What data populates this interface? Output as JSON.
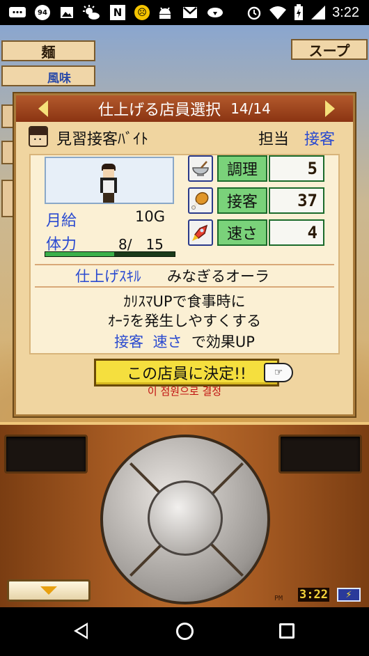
{
  "status_bar": {
    "time": "3:22",
    "icons": [
      "message-icon",
      "badge-94-icon",
      "image-icon",
      "weather-icon",
      "n-news-icon",
      "smiley-icon",
      "android-icon",
      "gmail-icon",
      "cloud-download-icon",
      "alarm-icon",
      "wifi-icon",
      "battery-charging-icon",
      "signal-icon"
    ],
    "badge_count": "94",
    "n_label": "N"
  },
  "background": {
    "left_tab": "麺",
    "right_tab": "スープ",
    "flavor": "風味"
  },
  "dialog": {
    "title": "仕上げる店員選択",
    "count": "14/14",
    "staff_name": "見習接客ﾊﾞｲﾄ",
    "role_label": "担当",
    "role_value": "接客",
    "salary_label": "月給",
    "salary_value": "10G",
    "stamina_label": "体力",
    "stamina_value": "8/　15",
    "stamina_current": 8,
    "stamina_max": 15,
    "stats": [
      {
        "name": "調理",
        "value": "5",
        "icon": "cooking-bowl-icon"
      },
      {
        "name": "接客",
        "value": "37",
        "icon": "chicken-leg-icon"
      },
      {
        "name": "速さ",
        "value": "4",
        "icon": "rocket-icon"
      }
    ],
    "skill_label": "仕上げｽｷﾙ",
    "skill_name": "みなぎるオーラ",
    "skill_desc_line1": "ｶﾘｽﾏUPで食事時に",
    "skill_desc_line2": "ｵｰﾗを発生しやすくする",
    "skill_effect_stat1": "接客",
    "skill_effect_stat2": "速さ",
    "skill_effect_suffix": "で効果UP",
    "confirm_button": "この店員に決定!!",
    "translation_caption": "이 점원으로 결정"
  },
  "controller": {
    "pm_label": "PM",
    "clock": "3:22",
    "battery_symbol": "⚡"
  },
  "colors": {
    "header_bg": "#8a3412",
    "dialog_bg": "#f0d5a0",
    "label_blue": "#2a4ad0",
    "stat_green": "#7ad27a",
    "button_yellow": "#f5df3e",
    "caption_red": "#c01010",
    "wood": "#b86b2c"
  }
}
